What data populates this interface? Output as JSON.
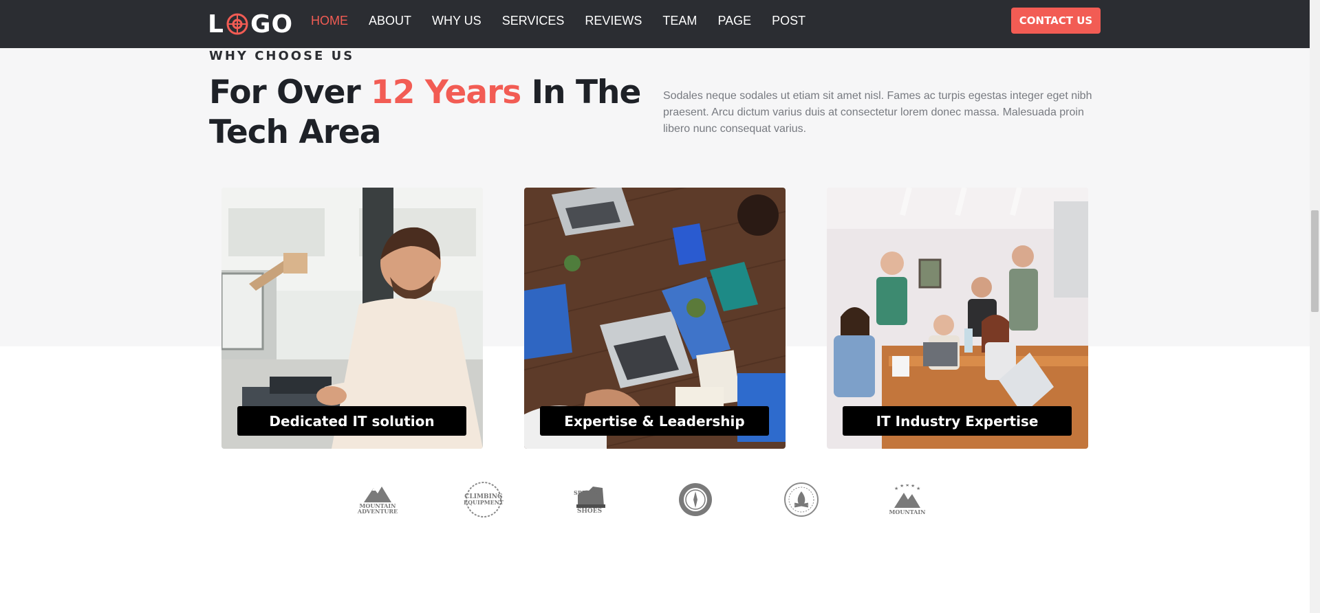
{
  "header": {
    "logo": {
      "left": "L",
      "right": "GO"
    },
    "nav": [
      {
        "label": "HOME",
        "active": true
      },
      {
        "label": "ABOUT",
        "active": false
      },
      {
        "label": "WHY US",
        "active": false
      },
      {
        "label": "SERVICES",
        "active": false
      },
      {
        "label": "REVIEWS",
        "active": false
      },
      {
        "label": "TEAM",
        "active": false
      },
      {
        "label": "PAGE",
        "active": false
      },
      {
        "label": "POST",
        "active": false
      }
    ],
    "contact_label": "CONTACT US"
  },
  "intro": {
    "eyebrow": "WHY CHOOSE US",
    "headline_before": "For Over ",
    "headline_accent": "12 Years",
    "headline_after": " In The Tech Area",
    "description": "Sodales neque sodales ut etiam sit amet nisl. Fames ac turpis egestas integer eget nibh praesent. Arcu dictum varius duis at consectetur lorem donec massa. Malesuada proin libero nunc consequat varius."
  },
  "cards": [
    {
      "label": "Dedicated IT solution",
      "icon": "man-at-laptop-photo"
    },
    {
      "label": "Expertise & Leadership",
      "icon": "team-table-laptops-photo"
    },
    {
      "label": "IT Industry Expertise",
      "icon": "team-meeting-photo"
    }
  ],
  "partners": [
    {
      "name": "mountain-adventure-logo",
      "text": [
        "MOUNTAIN",
        "ADVENTURE"
      ]
    },
    {
      "name": "climbing-equipment-logo",
      "text": [
        "CLIMBING",
        "EQUIPMENT"
      ]
    },
    {
      "name": "special-shoes-logo",
      "text": [
        "SPECIAL",
        "SHOES"
      ]
    },
    {
      "name": "compass-badge-logo",
      "text": []
    },
    {
      "name": "campfire-badge-logo",
      "text": []
    },
    {
      "name": "mountain-stars-logo",
      "text": [
        "MOUNTAIN"
      ]
    }
  ],
  "colors": {
    "accent": "#f25c54",
    "nav_bg": "#2b2d32",
    "band_bg": "#f6f6f7",
    "heading": "#1e2127",
    "body_text": "#777a80"
  }
}
